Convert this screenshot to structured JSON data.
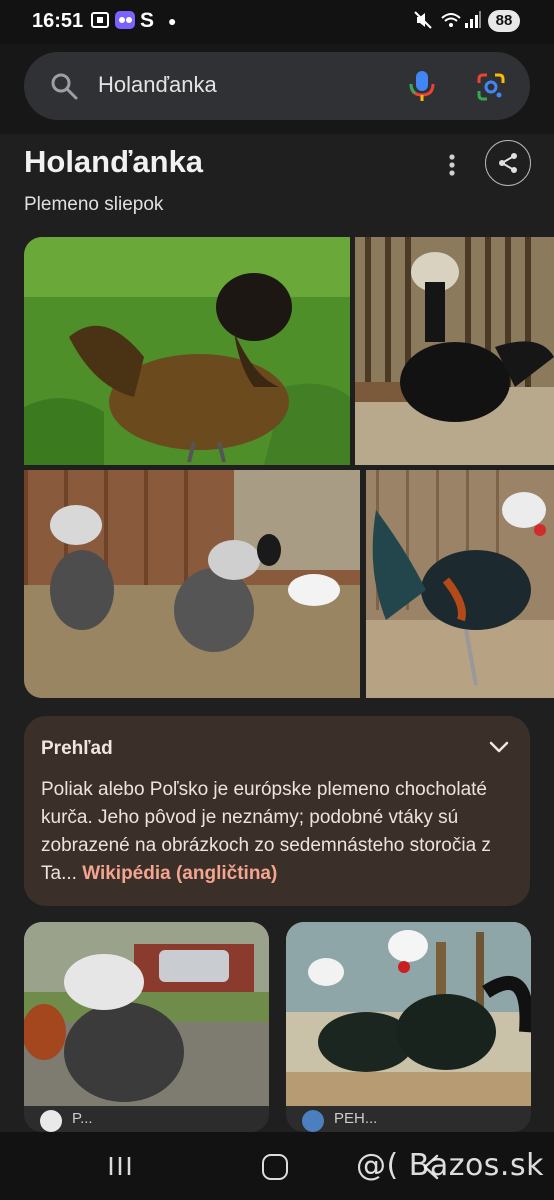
{
  "status_bar": {
    "time": "16:51",
    "app_letter": "S",
    "battery": "88"
  },
  "search": {
    "query": "Holanďanka"
  },
  "knowledge_panel": {
    "title": "Holanďanka",
    "subtitle": "Plemeno sliepok"
  },
  "overview": {
    "title": "Prehľad",
    "text": "Poliak alebo Poľsko je európske plemeno chocholaté kurča. Jeho pôvod je neznámy; podobné vtáky sú zobrazené na obrázkoch zo sedemnásteho storočia z Ta...",
    "link": "Wikipédia (angličtina)"
  },
  "cards": [
    {
      "source": "P..."
    },
    {
      "source": "PEH..."
    }
  ],
  "watermark": "@( Bazos.sk",
  "colors": {
    "background": "#1f1f1f",
    "overview_bg": "#3b2f2a",
    "link": "#f4a58f"
  }
}
